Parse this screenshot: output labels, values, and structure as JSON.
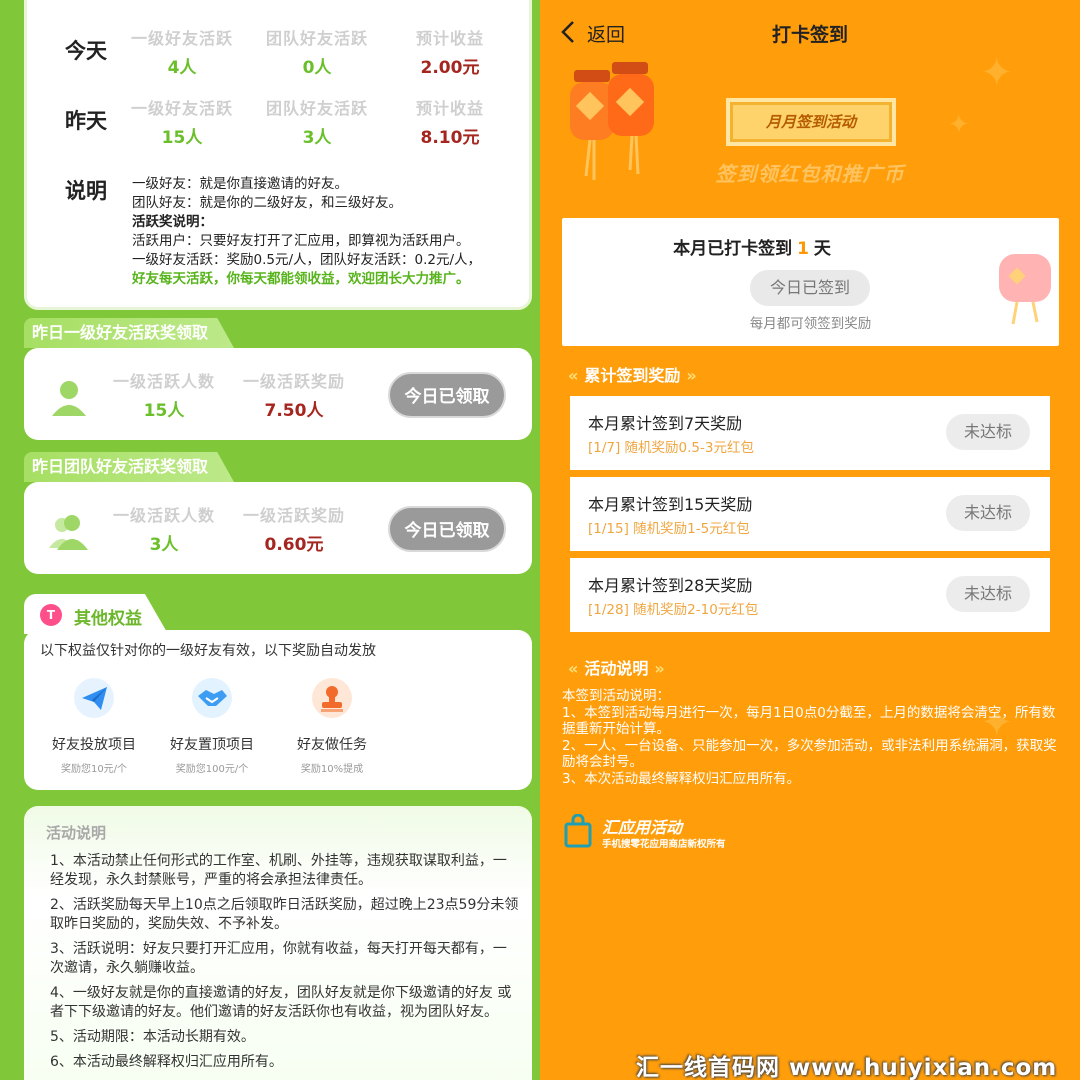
{
  "left": {
    "stats": {
      "today": {
        "label": "今天",
        "cols": [
          {
            "label": "一级好友活跃",
            "value": "4人"
          },
          {
            "label": "团队好友活跃",
            "value": "0人"
          },
          {
            "label": "预计收益",
            "value": "2.00元"
          }
        ]
      },
      "yesterday": {
        "label": "昨天",
        "cols": [
          {
            "label": "一级好友活跃",
            "value": "15人"
          },
          {
            "label": "团队好友活跃",
            "value": "3人"
          },
          {
            "label": "预计收益",
            "value": "8.10元"
          }
        ]
      },
      "desc_label": "说明",
      "desc": [
        "一级好友：就是你直接邀请的好友。",
        "团队好友：就是你的二级好友，和三级好友。",
        "活跃奖说明：",
        "活跃用户：只要好友打开了汇应用，即算视为活跃用户。",
        "一级好友活跃：奖励0.5元/人，团队好友活跃：0.2元/人，",
        "好友每天活跃，你每天都能领收益，欢迎团长大力推广。"
      ]
    },
    "award1": {
      "title": "昨日一级好友活跃奖领取",
      "col1_label": "一级活跃人数",
      "col1_value": "15人",
      "col2_label": "一级活跃奖励",
      "col2_value": "7.50人",
      "button": "今日已领取"
    },
    "award2": {
      "title": "昨日团队好友活跃奖领取",
      "col1_label": "一级活跃人数",
      "col1_value": "3人",
      "col2_label": "一级活跃奖励",
      "col2_value": "0.60元",
      "button": "今日已领取"
    },
    "other": {
      "tab_icon": "T",
      "title": "其他权益",
      "desc": "以下权益仅针对你的一级好友有效，以下奖励自动发放",
      "items": [
        {
          "name": "好友投放项目",
          "sub": "奖励您10元/个",
          "icon": "paper-plane-icon"
        },
        {
          "name": "好友置顶项目",
          "sub": "奖励您100元/个",
          "icon": "handshake-icon"
        },
        {
          "name": "好友做任务",
          "sub": "奖励10%提成",
          "icon": "stamp-icon"
        }
      ]
    },
    "activity": {
      "title": "活动说明",
      "items": [
        "1、本活动禁止任何形式的工作室、机刷、外挂等，违规获取谋取利益，一经发现，永久封禁账号，严重的将会承担法律责任。",
        "2、活跃奖励每天早上10点之后领取昨日活跃奖励，超过晚上23点59分未领取昨日奖励的，奖励失效、不予补发。",
        "3、活跃说明：好友只要打开汇应用，你就有收益，每天打开每天都有，一次邀请，永久躺赚收益。",
        "4、一级好友就是你的直接邀请的好友，团队好友就是你下级邀请的好友 或者下下级邀请的好友。他们邀请的好友活跃你也有收益，视为团队好友。",
        "5、活动期限：本活动长期有效。",
        "6、本活动最终解释权归汇应用所有。"
      ]
    }
  },
  "right": {
    "back": "返回",
    "title": "打卡签到",
    "banner": "月月签到活动",
    "slogan": "签到领红包和推广币",
    "sign": {
      "prefix": "本月已打卡签到",
      "count": "1",
      "suffix": "天",
      "button": "今日已签到",
      "note": "每月都可领签到奖励"
    },
    "rewards_title": "累计签到奖励",
    "rewards": [
      {
        "title": "本月累计签到7天奖励",
        "sub": "[1/7] 随机奖励0.5-3元红包",
        "status": "未达标"
      },
      {
        "title": "本月累计签到15天奖励",
        "sub": "[1/15] 随机奖励1-5元红包",
        "status": "未达标"
      },
      {
        "title": "本月累计签到28天奖励",
        "sub": "[1/28] 随机奖励2-10元红包",
        "status": "未达标"
      }
    ],
    "rules_title": "活动说明",
    "rules": [
      "本签到活动说明：",
      "1、本签到活动每月进行一次，每月1日0点0分截至，上月的数据将会清空，所有数据重新开始计算。",
      "2、一人、一台设备、只能参加一次，多次参加活动，或非法利用系统漏洞，获取奖励将会封号。",
      "3、本次活动最终解释权归汇应用所有。"
    ],
    "brand_title": "汇应用活动",
    "brand_sub": "手机搜零花应用商店新权所有"
  },
  "watermark": "汇一线首码网 www.huiyixian.com",
  "colors": {
    "green": "#80c83a",
    "orange": "#ff9d0a",
    "dark_red": "#a5261f",
    "gold": "#ff9800"
  }
}
